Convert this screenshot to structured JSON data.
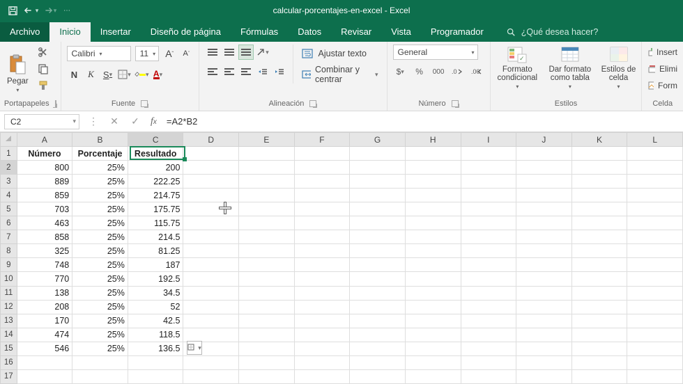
{
  "titlebar": {
    "document": "calcular-porcentajes-en-excel - Excel"
  },
  "tabs": {
    "file": "Archivo",
    "items": [
      "Inicio",
      "Insertar",
      "Diseño de página",
      "Fórmulas",
      "Datos",
      "Revisar",
      "Vista",
      "Programador"
    ],
    "active_index": 0,
    "tell_me": "¿Qué desea hacer?"
  },
  "ribbon": {
    "clipboard": {
      "paste": "Pegar",
      "label": "Portapapeles"
    },
    "font": {
      "name": "Calibri",
      "size": "11",
      "label": "Fuente"
    },
    "alignment": {
      "wrap": "Ajustar texto",
      "merge": "Combinar y centrar",
      "label": "Alineación"
    },
    "number": {
      "format": "General",
      "label": "Número"
    },
    "styles": {
      "cond": "Formato condicional",
      "table": "Dar formato como tabla",
      "cell": "Estilos de celda",
      "label": "Estilos"
    },
    "cells": {
      "insert": "Insert",
      "delete": "Elimi",
      "format": "Form",
      "label": "Celda"
    }
  },
  "formula_bar": {
    "name_box": "C2",
    "formula": "=A2*B2"
  },
  "columns": [
    "A",
    "B",
    "C",
    "D",
    "E",
    "F",
    "G",
    "H",
    "I",
    "J",
    "K",
    "L"
  ],
  "row_headers": [
    1,
    2,
    3,
    4,
    5,
    6,
    7,
    8,
    9,
    10,
    11,
    12,
    13,
    14,
    15,
    16,
    17
  ],
  "grid": {
    "headers": [
      "Número",
      "Porcentaje",
      "Resultado"
    ],
    "rows": [
      {
        "a": "800",
        "b": "25%",
        "c": "200"
      },
      {
        "a": "889",
        "b": "25%",
        "c": "222.25"
      },
      {
        "a": "859",
        "b": "25%",
        "c": "214.75"
      },
      {
        "a": "703",
        "b": "25%",
        "c": "175.75"
      },
      {
        "a": "463",
        "b": "25%",
        "c": "115.75"
      },
      {
        "a": "858",
        "b": "25%",
        "c": "214.5"
      },
      {
        "a": "325",
        "b": "25%",
        "c": "81.25"
      },
      {
        "a": "748",
        "b": "25%",
        "c": "187"
      },
      {
        "a": "770",
        "b": "25%",
        "c": "192.5"
      },
      {
        "a": "138",
        "b": "25%",
        "c": "34.5"
      },
      {
        "a": "208",
        "b": "25%",
        "c": "52"
      },
      {
        "a": "170",
        "b": "25%",
        "c": "42.5"
      },
      {
        "a": "474",
        "b": "25%",
        "c": "118.5"
      },
      {
        "a": "546",
        "b": "25%",
        "c": "136.5"
      }
    ]
  },
  "chart_data": {
    "type": "table",
    "title": "calcular-porcentajes-en-excel",
    "columns": [
      "Número",
      "Porcentaje",
      "Resultado"
    ],
    "rows": [
      [
        800,
        0.25,
        200
      ],
      [
        889,
        0.25,
        222.25
      ],
      [
        859,
        0.25,
        214.75
      ],
      [
        703,
        0.25,
        175.75
      ],
      [
        463,
        0.25,
        115.75
      ],
      [
        858,
        0.25,
        214.5
      ],
      [
        325,
        0.25,
        81.25
      ],
      [
        748,
        0.25,
        187
      ],
      [
        770,
        0.25,
        192.5
      ],
      [
        138,
        0.25,
        34.5
      ],
      [
        208,
        0.25,
        52
      ],
      [
        170,
        0.25,
        42.5
      ],
      [
        474,
        0.25,
        118.5
      ],
      [
        546,
        0.25,
        136.5
      ]
    ],
    "formula_c": "=A*B"
  }
}
